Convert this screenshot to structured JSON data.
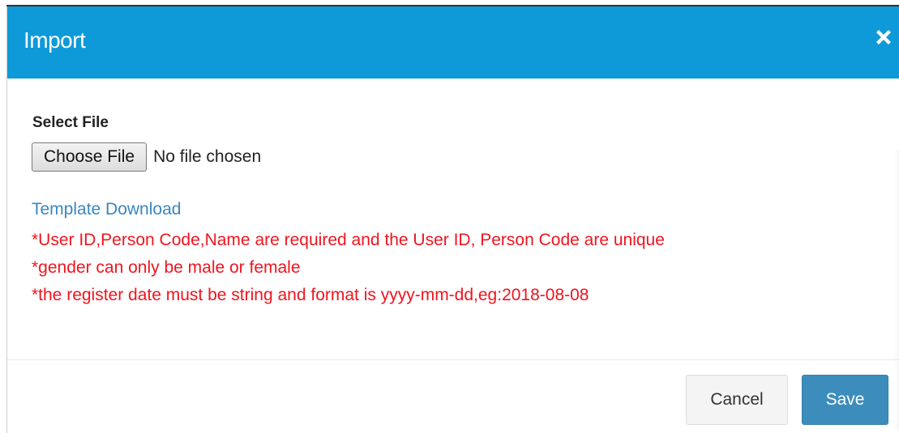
{
  "dialog": {
    "title": "Import",
    "close_icon": "close-icon"
  },
  "form": {
    "select_file_label": "Select File",
    "choose_file_button": "Choose File",
    "file_status": "No file chosen",
    "template_link": "Template Download",
    "notes": [
      "*User ID,Person Code,Name are required and the User ID, Person Code are unique",
      "*gender can only be male or female",
      "*the register date must be string and format is yyyy-mm-dd,eg:2018-08-08"
    ]
  },
  "footer": {
    "cancel_label": "Cancel",
    "save_label": "Save"
  },
  "colors": {
    "header": "#0e9ad8",
    "link": "#3a87c0",
    "note": "#f0141e",
    "save": "#3c8dbc"
  }
}
